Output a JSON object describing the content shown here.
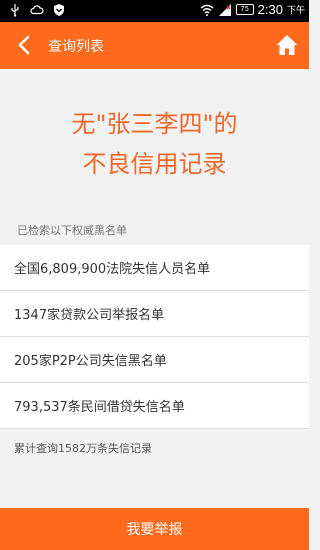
{
  "status_bar": {
    "time": "2:30",
    "ampm": "下午",
    "battery": "75",
    "icons": [
      "usb-icon",
      "cloud-icon",
      "shield-icon",
      "wifi-icon",
      "signal-icon",
      "battery-icon"
    ]
  },
  "app_bar": {
    "title": "查询列表",
    "back_icon": "back-arrow-icon",
    "home_icon": "home-icon",
    "color": "#ff6a1c"
  },
  "headline": {
    "line1": "无\"张三李四\"的",
    "line2": "不良信用记录",
    "color": "#f0672a"
  },
  "section_label": "已检索以下权威黑名单",
  "list": {
    "items": [
      "全国6,809,900法院失信人员名单",
      "1347家贷款公司举报名单",
      "205家P2P公司失信黑名单",
      "793,537条民间借贷失信名单"
    ]
  },
  "footnote": "累计查询1582万条失信记录",
  "report_button": "我要举报"
}
